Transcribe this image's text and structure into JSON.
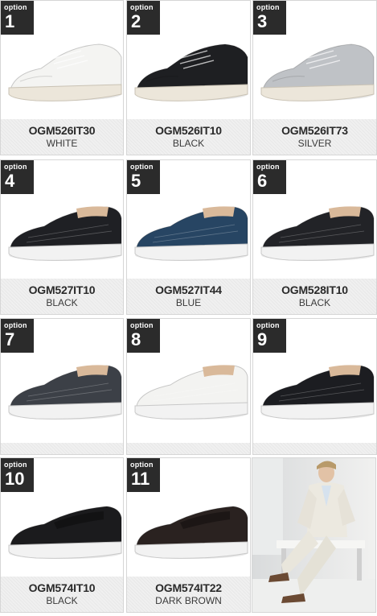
{
  "options": [
    {
      "badge_label": "option",
      "number": "1",
      "code": "OGM526IT30",
      "color": "WHITE",
      "style": "oxford",
      "shoe_color": "#f4f4f2",
      "sole": "#ece6da"
    },
    {
      "badge_label": "option",
      "number": "2",
      "code": "OGM526IT10",
      "color": "BLACK",
      "style": "oxford",
      "shoe_color": "#1e1f22",
      "sole": "#ece6da"
    },
    {
      "badge_label": "option",
      "number": "3",
      "code": "OGM526IT73",
      "color": "SILVER",
      "style": "oxford",
      "shoe_color": "#bfc2c6",
      "sole": "#ece6da"
    },
    {
      "badge_label": "option",
      "number": "4",
      "code": "OGM527IT10",
      "color": "BLACK",
      "style": "slipon",
      "shoe_color": "#1f2024",
      "sole": "#f2f2f2"
    },
    {
      "badge_label": "option",
      "number": "5",
      "code": "OGM527IT44",
      "color": "BLUE",
      "style": "slipon",
      "shoe_color": "#274563",
      "sole": "#f2f2f2"
    },
    {
      "badge_label": "option",
      "number": "6",
      "code": "OGM528IT10",
      "color": "BLACK",
      "style": "slipon",
      "shoe_color": "#222327",
      "sole": "#f2f2f2"
    },
    {
      "badge_label": "option",
      "number": "7",
      "code": "",
      "color": "",
      "style": "slipon",
      "shoe_color": "#3c4047",
      "sole": "#f2f2f2"
    },
    {
      "badge_label": "option",
      "number": "8",
      "code": "",
      "color": "",
      "style": "slipon",
      "shoe_color": "#f3f3f1",
      "sole": "#f2f2f2"
    },
    {
      "badge_label": "option",
      "number": "9",
      "code": "",
      "color": "",
      "style": "slipon",
      "shoe_color": "#1c1d21",
      "sole": "#f2f2f2"
    },
    {
      "badge_label": "option",
      "number": "10",
      "code": "OGM574IT10",
      "color": "BLACK",
      "style": "loafer",
      "shoe_color": "#1b1b1d",
      "sole": "#f2f2f2"
    },
    {
      "badge_label": "option",
      "number": "11",
      "code": "OGM574IT22",
      "color": "DARK BROWN",
      "style": "loafer",
      "shoe_color": "#2a2220",
      "sole": "#f2f2f2"
    }
  ],
  "colors": {
    "badge_bg": "#2b2b2b",
    "caption_bg": "#f0f0f0",
    "border": "#d6d6d6",
    "model_suit": "#ece9e0",
    "model_shirt": "#d6e2ee",
    "model_shoes": "#6b4a33"
  }
}
